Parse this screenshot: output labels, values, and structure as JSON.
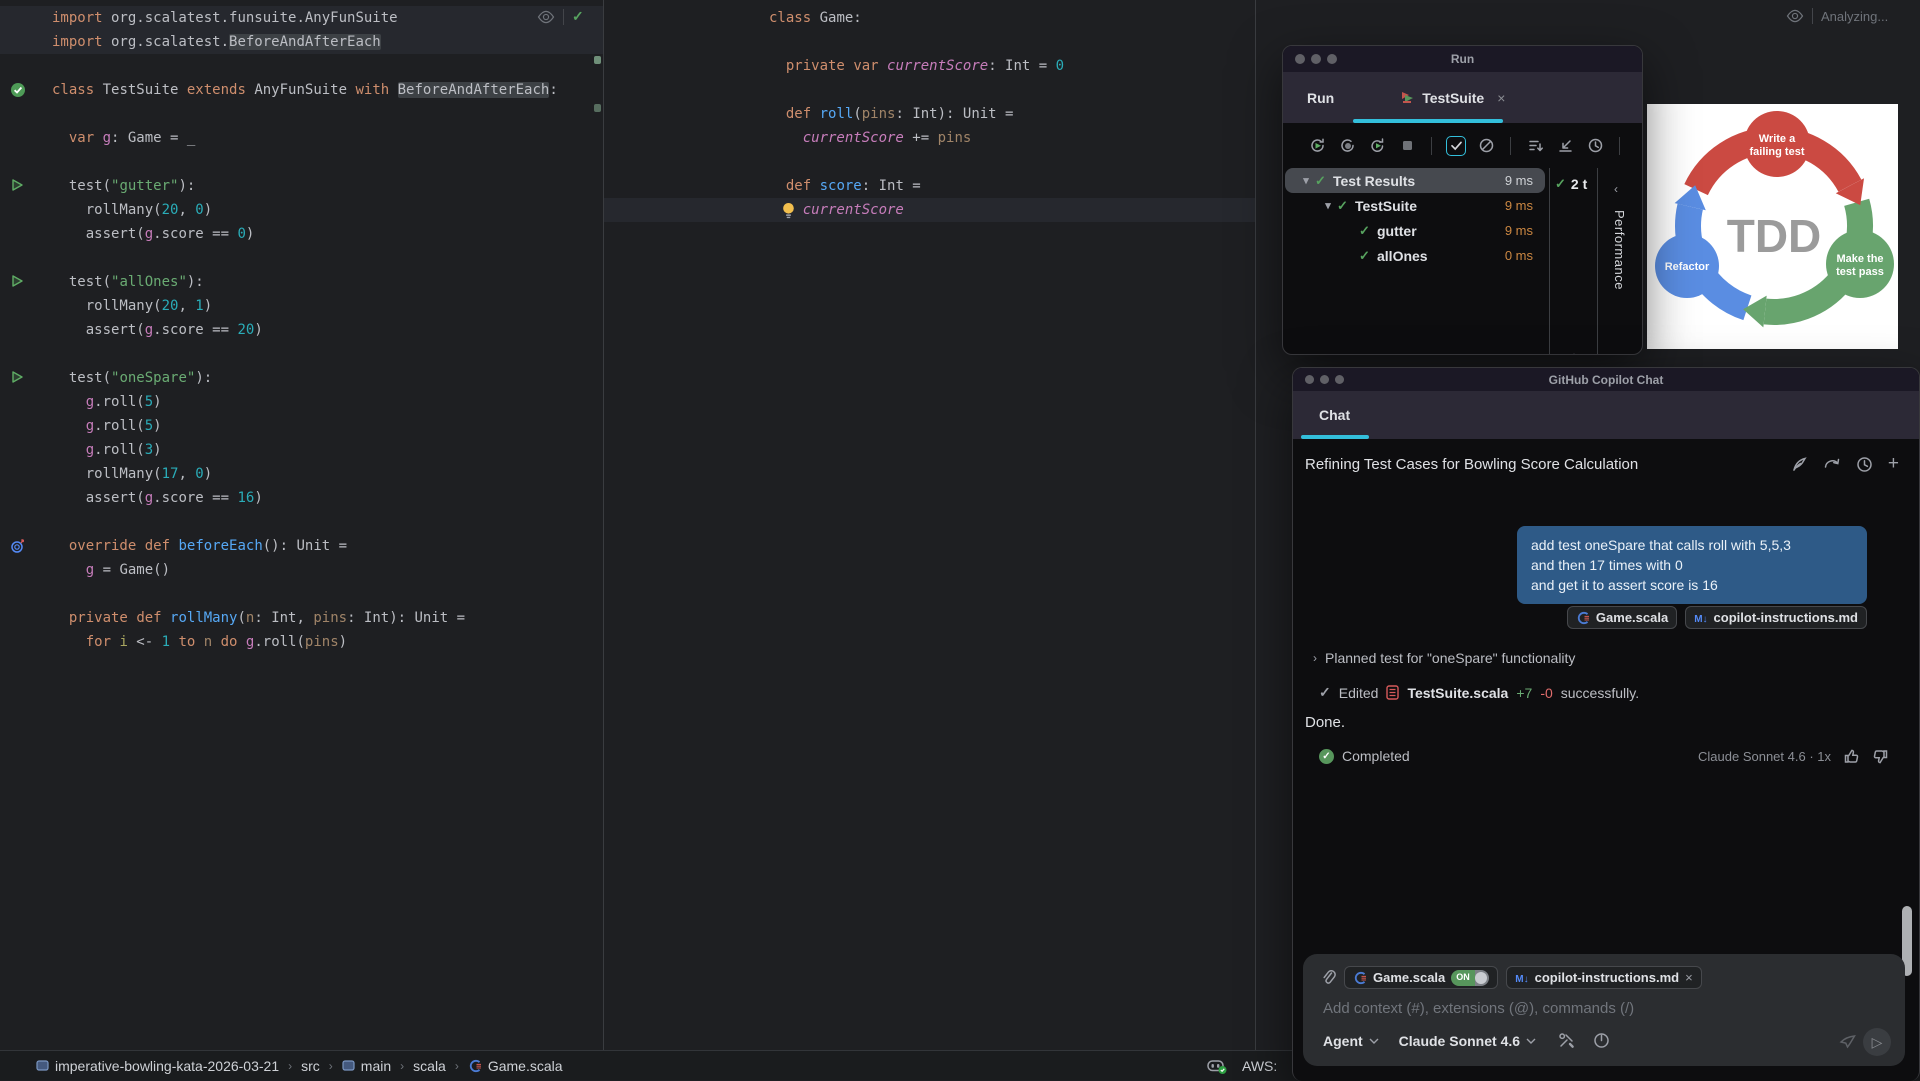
{
  "accent": "#33bfdb",
  "left_editor": {
    "inspection_check": "✓",
    "lines": [
      {
        "band": true,
        "seg": [
          [
            "kw",
            "import"
          ],
          [
            "pl",
            " org.scalatest.funsuite.AnyFunSuite"
          ]
        ]
      },
      {
        "band": true,
        "seg": [
          [
            "kw",
            "import"
          ],
          [
            "pl",
            " org.scalatest."
          ],
          [
            "box",
            "BeforeAndAfterEach"
          ]
        ]
      },
      {
        "seg": []
      },
      {
        "gutter": "pass",
        "seg": [
          [
            "kw",
            "class"
          ],
          [
            "pl",
            " TestSuite "
          ],
          [
            "kw",
            "extends"
          ],
          [
            "pl",
            " AnyFunSuite "
          ],
          [
            "kw",
            "with"
          ],
          [
            "pl",
            " "
          ],
          [
            "box",
            "BeforeAndAfterEach"
          ],
          [
            "pl",
            ":"
          ]
        ]
      },
      {
        "seg": []
      },
      {
        "seg": [
          [
            "pl",
            "  "
          ],
          [
            "kw",
            "var"
          ],
          [
            "vr",
            " g"
          ],
          [
            "pl",
            ": Game = _"
          ]
        ]
      },
      {
        "seg": []
      },
      {
        "gutter": "run",
        "seg": [
          [
            "pl",
            "  test("
          ],
          [
            "str",
            "\"gutter\""
          ],
          [
            "pl",
            "):"
          ]
        ]
      },
      {
        "seg": [
          [
            "pl",
            "    rollMany("
          ],
          [
            "num",
            "20"
          ],
          [
            "pl",
            ", "
          ],
          [
            "num",
            "0"
          ],
          [
            "pl",
            ")"
          ]
        ]
      },
      {
        "seg": [
          [
            "pl",
            "    assert("
          ],
          [
            "vr",
            "g"
          ],
          [
            "pl",
            ".score == "
          ],
          [
            "num",
            "0"
          ],
          [
            "pl",
            ")"
          ]
        ]
      },
      {
        "seg": []
      },
      {
        "gutter": "run",
        "seg": [
          [
            "pl",
            "  test("
          ],
          [
            "str",
            "\"allOnes\""
          ],
          [
            "pl",
            "):"
          ]
        ]
      },
      {
        "seg": [
          [
            "pl",
            "    rollMany("
          ],
          [
            "num",
            "20"
          ],
          [
            "pl",
            ", "
          ],
          [
            "num",
            "1"
          ],
          [
            "pl",
            ")"
          ]
        ]
      },
      {
        "seg": [
          [
            "pl",
            "    assert("
          ],
          [
            "vr",
            "g"
          ],
          [
            "pl",
            ".score == "
          ],
          [
            "num",
            "20"
          ],
          [
            "pl",
            ")"
          ]
        ]
      },
      {
        "seg": []
      },
      {
        "gutter": "run",
        "seg": [
          [
            "pl",
            "  test("
          ],
          [
            "str",
            "\"oneSpare\""
          ],
          [
            "pl",
            "):"
          ]
        ]
      },
      {
        "seg": [
          [
            "pl",
            "    "
          ],
          [
            "vr",
            "g"
          ],
          [
            "pl",
            ".roll("
          ],
          [
            "num",
            "5"
          ],
          [
            "pl",
            ")"
          ]
        ]
      },
      {
        "seg": [
          [
            "pl",
            "    "
          ],
          [
            "vr",
            "g"
          ],
          [
            "pl",
            ".roll("
          ],
          [
            "num",
            "5"
          ],
          [
            "pl",
            ")"
          ]
        ]
      },
      {
        "seg": [
          [
            "pl",
            "    "
          ],
          [
            "vr",
            "g"
          ],
          [
            "pl",
            ".roll("
          ],
          [
            "num",
            "3"
          ],
          [
            "pl",
            ")"
          ]
        ]
      },
      {
        "seg": [
          [
            "pl",
            "    rollMany("
          ],
          [
            "num",
            "17"
          ],
          [
            "pl",
            ", "
          ],
          [
            "num",
            "0"
          ],
          [
            "pl",
            ")"
          ]
        ]
      },
      {
        "seg": [
          [
            "pl",
            "    assert("
          ],
          [
            "vr",
            "g"
          ],
          [
            "pl",
            ".score == "
          ],
          [
            "num",
            "16"
          ],
          [
            "pl",
            ")"
          ]
        ]
      },
      {
        "seg": []
      },
      {
        "gutter": "override",
        "seg": [
          [
            "pl",
            "  "
          ],
          [
            "kw",
            "override"
          ],
          [
            "pl",
            " "
          ],
          [
            "kw",
            "def"
          ],
          [
            "fn",
            " beforeEach"
          ],
          [
            "pl",
            "(): Unit ="
          ]
        ]
      },
      {
        "seg": [
          [
            "pl",
            "    "
          ],
          [
            "vr",
            "g"
          ],
          [
            "pl",
            " = Game()"
          ]
        ]
      },
      {
        "seg": []
      },
      {
        "seg": [
          [
            "pl",
            "  "
          ],
          [
            "kw",
            "private"
          ],
          [
            "pl",
            " "
          ],
          [
            "kw",
            "def"
          ],
          [
            "fn",
            " rollMany"
          ],
          [
            "pl",
            "("
          ],
          [
            "par",
            "n"
          ],
          [
            "pl",
            ": Int, "
          ],
          [
            "par",
            "pins"
          ],
          [
            "pl",
            ": Int): Unit ="
          ]
        ]
      },
      {
        "seg": [
          [
            "pl",
            "    "
          ],
          [
            "kw",
            "for"
          ],
          [
            "lv",
            " i"
          ],
          [
            "pl",
            " <- "
          ],
          [
            "num",
            "1"
          ],
          [
            "kw",
            " to"
          ],
          [
            "par",
            " n"
          ],
          [
            "kw",
            " do"
          ],
          [
            "vr",
            " g"
          ],
          [
            "pl",
            ".roll("
          ],
          [
            "par",
            "pins"
          ],
          [
            "pl",
            ")"
          ]
        ]
      }
    ]
  },
  "middle_editor": {
    "lines": [
      {
        "seg": [
          [
            "kw",
            "class"
          ],
          [
            "pl",
            " Game:"
          ]
        ]
      },
      {
        "seg": []
      },
      {
        "seg": [
          [
            "pl",
            "  "
          ],
          [
            "kw",
            "private"
          ],
          [
            "pl",
            " "
          ],
          [
            "kw",
            "var"
          ],
          [
            "fld",
            " currentScore"
          ],
          [
            "pl",
            ": Int = "
          ],
          [
            "num",
            "0"
          ]
        ]
      },
      {
        "seg": []
      },
      {
        "seg": [
          [
            "pl",
            "  "
          ],
          [
            "kw",
            "def"
          ],
          [
            "fn",
            " roll"
          ],
          [
            "pl",
            "("
          ],
          [
            "par",
            "pins"
          ],
          [
            "pl",
            ": Int): Unit ="
          ]
        ]
      },
      {
        "seg": [
          [
            "pl",
            "    "
          ],
          [
            "fld",
            "currentScore"
          ],
          [
            "pl",
            " += "
          ],
          [
            "par",
            "pins"
          ]
        ]
      },
      {
        "seg": []
      },
      {
        "seg": [
          [
            "pl",
            "  "
          ],
          [
            "kw",
            "def"
          ],
          [
            "fn",
            " score"
          ],
          [
            "pl",
            ": Int ="
          ]
        ]
      },
      {
        "gutter": "bulb",
        "band": true,
        "seg": [
          [
            "pl",
            "    "
          ],
          [
            "fld",
            "currentScore"
          ]
        ]
      }
    ]
  },
  "right_pane": {
    "status": "Analyzing...",
    "tdd": {
      "center": "TDD",
      "top": [
        "Write a",
        "failing test"
      ],
      "right": [
        "Make the",
        "test pass"
      ],
      "left": "Refactor",
      "colors": {
        "red": "#cb4a42",
        "green": "#68a46e",
        "blue": "#5a8de2"
      }
    }
  },
  "run_panel": {
    "window_title": "Run",
    "tab_run": "Run",
    "tab_test": "TestSuite",
    "toolbar": [
      "rerun-tests-icon",
      "rerun-failed-tests-icon",
      "rerun-auto-icon",
      "stop-icon",
      "sep",
      "show-passed-icon",
      "show-ignored-icon",
      "sep",
      "sort-tests-icon",
      "import-test-results-icon",
      "test-history-icon",
      "sep"
    ],
    "tree": [
      {
        "expand": true,
        "label": "Test Results",
        "time": "9 ms",
        "indent": 0,
        "selected": true
      },
      {
        "expand": true,
        "label": "TestSuite",
        "time": "9 ms",
        "indent": 1
      },
      {
        "label": "gutter",
        "time": "9 ms",
        "indent": 2
      },
      {
        "label": "allOnes",
        "time": "0 ms",
        "indent": 2
      }
    ],
    "passed_badge": "2 t",
    "performance_tab": "Performance"
  },
  "chat_panel": {
    "window_title": "GitHub Copilot Chat",
    "tab": "Chat",
    "thread_title": "Refining Test Cases for Bowling Score Calculation",
    "bubble_lines": [
      "add test oneSpare that calls roll with 5,5,3",
      "and then 17 times with 0",
      "and get it to assert score is 16"
    ],
    "attachments": [
      {
        "icon": "scala",
        "label": "Game.scala"
      },
      {
        "icon": "md",
        "label": "copilot-instructions.md"
      }
    ],
    "planned_row": "Planned test for \"oneSpare\" functionality",
    "edited": {
      "verb": "Edited",
      "file": "TestSuite.scala",
      "added": "+7",
      "removed": "-0",
      "suffix": "successfully."
    },
    "done": "Done.",
    "completed": "Completed",
    "model_info": "Claude Sonnet 4.6 · 1x",
    "input": {
      "chips": [
        {
          "icon": "scala",
          "label": "Game.scala",
          "toggle": "ON"
        },
        {
          "icon": "md",
          "label": "copilot-instructions.md",
          "close": true
        }
      ],
      "placeholder": "Add context (#), extensions (@), commands (/)",
      "agent": "Agent",
      "model": "Claude Sonnet 4.6"
    }
  },
  "status_bar": {
    "breadcrumbs": [
      {
        "icon": "folder",
        "label": "imperative-bowling-kata-2026-03-21"
      },
      {
        "label": "src"
      },
      {
        "icon": "folder",
        "label": "main"
      },
      {
        "label": "scala"
      },
      {
        "icon": "scala",
        "label": "Game.scala"
      }
    ],
    "aws_label": "AWS:"
  }
}
